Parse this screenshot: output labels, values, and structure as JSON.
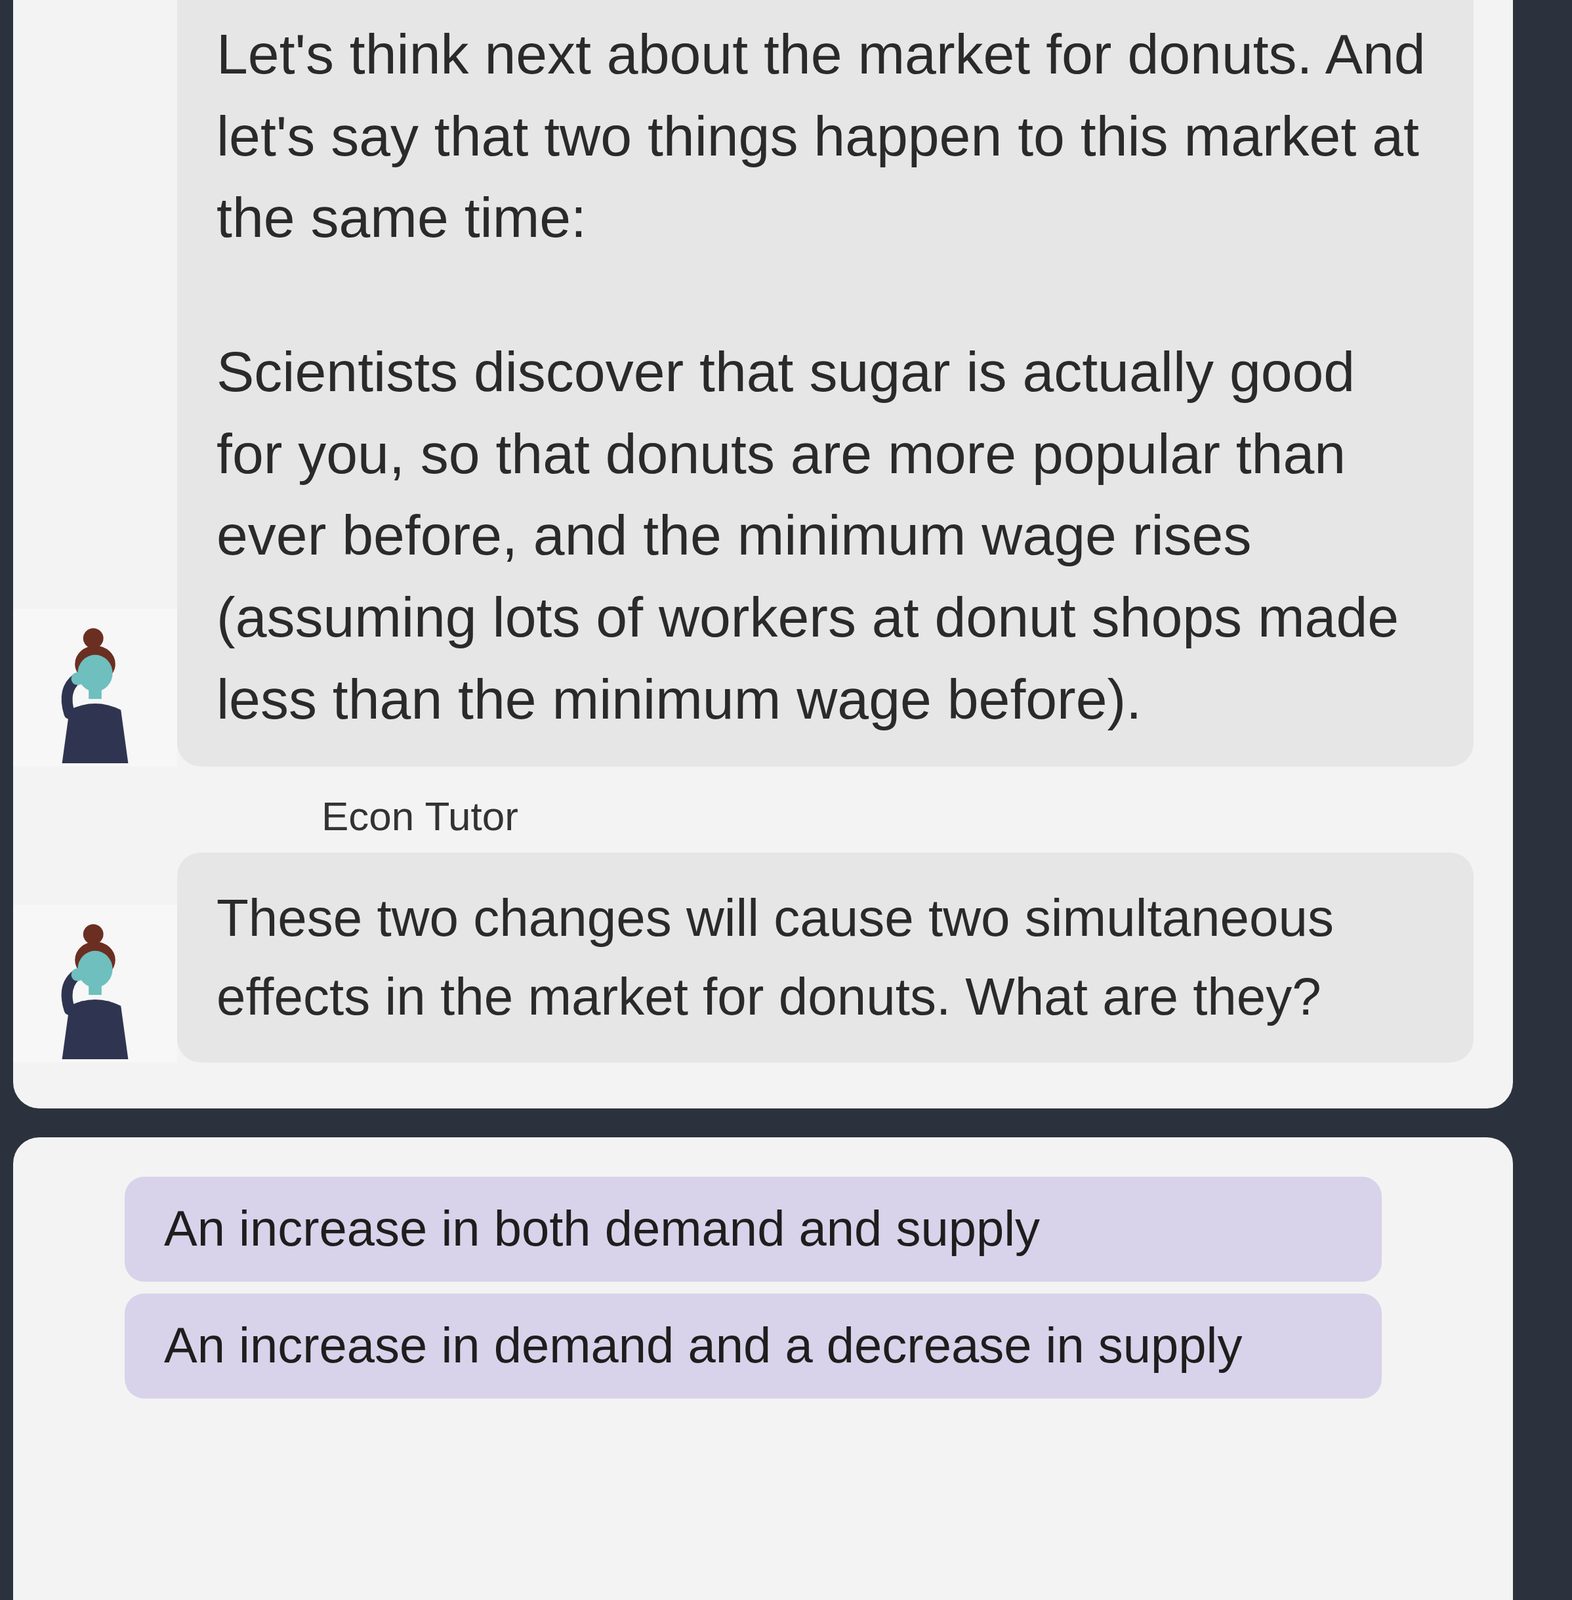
{
  "messages": [
    {
      "label": "",
      "paragraphs": [
        "Let's think next about the market for donuts. And let's say that two things happen to this market at the same time:",
        "Scientists discover that sugar is actually good for you, so that donuts are more popular than ever before, and the minimum wage rises (assuming lots of workers at donut shops made less than the minimum wage before)."
      ]
    },
    {
      "label": "Econ Tutor",
      "paragraphs": [
        "These two changes will cause two simultaneous effects in the market for donuts. What are they?"
      ]
    }
  ],
  "options": [
    {
      "label": "An increase in both demand and supply",
      "selected": false
    },
    {
      "label": "An increase in demand and a decrease in supply",
      "selected": false
    }
  ]
}
